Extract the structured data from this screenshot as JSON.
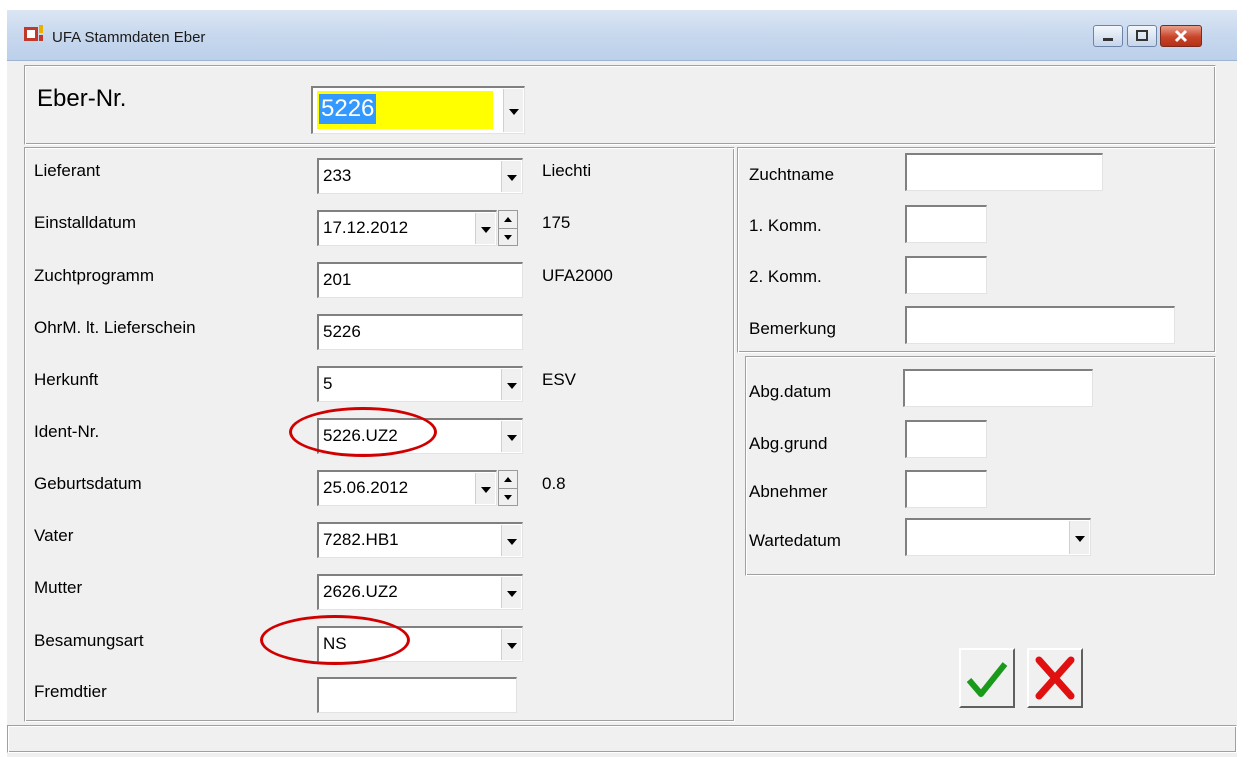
{
  "window": {
    "title": "UFA Stammdaten Eber",
    "controls": {
      "minimize": "minimize-icon",
      "maximize": "maximize-icon",
      "close": "close-icon"
    }
  },
  "header": {
    "label": "Eber-Nr.",
    "value": "5226",
    "highlight_color": "#ffff00",
    "selection_color": "#3399ff"
  },
  "left": {
    "lieferant": {
      "label": "Lieferant",
      "value": "233",
      "info": "Liechti"
    },
    "einstalldatum": {
      "label": "Einstalldatum",
      "value": "17.12.2012",
      "info": "175"
    },
    "zuchtprogramm": {
      "label": "Zuchtprogramm",
      "value": "201",
      "info": "UFA2000"
    },
    "ohrm": {
      "label": "OhrM. lt. Lieferschein",
      "value": "5226"
    },
    "herkunft": {
      "label": "Herkunft",
      "value": "5",
      "info": "ESV"
    },
    "ident": {
      "label": "Ident-Nr.",
      "value": "5226.UZ2"
    },
    "geburtsdatum": {
      "label": "Geburtsdatum",
      "value": "25.06.2012",
      "info": "0.8"
    },
    "vater": {
      "label": "Vater",
      "value": "7282.HB1"
    },
    "mutter": {
      "label": "Mutter",
      "value": "2626.UZ2"
    },
    "besamungsart": {
      "label": "Besamungsart",
      "value": "NS"
    },
    "fremdtier": {
      "label": "Fremdtier",
      "value": ""
    }
  },
  "right_top": {
    "zuchtname": {
      "label": "Zuchtname",
      "value": ""
    },
    "komm1": {
      "label": "1. Komm.",
      "value": ""
    },
    "komm2": {
      "label": "2. Komm.",
      "value": ""
    },
    "bemerkung": {
      "label": "Bemerkung",
      "value": ""
    }
  },
  "right_bottom": {
    "abgdatum": {
      "label": "Abg.datum",
      "value": ""
    },
    "abggrund": {
      "label": "Abg.grund",
      "value": ""
    },
    "abnehmer": {
      "label": "Abnehmer",
      "value": ""
    },
    "wartedatum": {
      "label": "Wartedatum",
      "value": ""
    }
  },
  "actions": {
    "ok": "checkmark-icon",
    "cancel": "cross-icon"
  },
  "annotation_color": "#d00000"
}
